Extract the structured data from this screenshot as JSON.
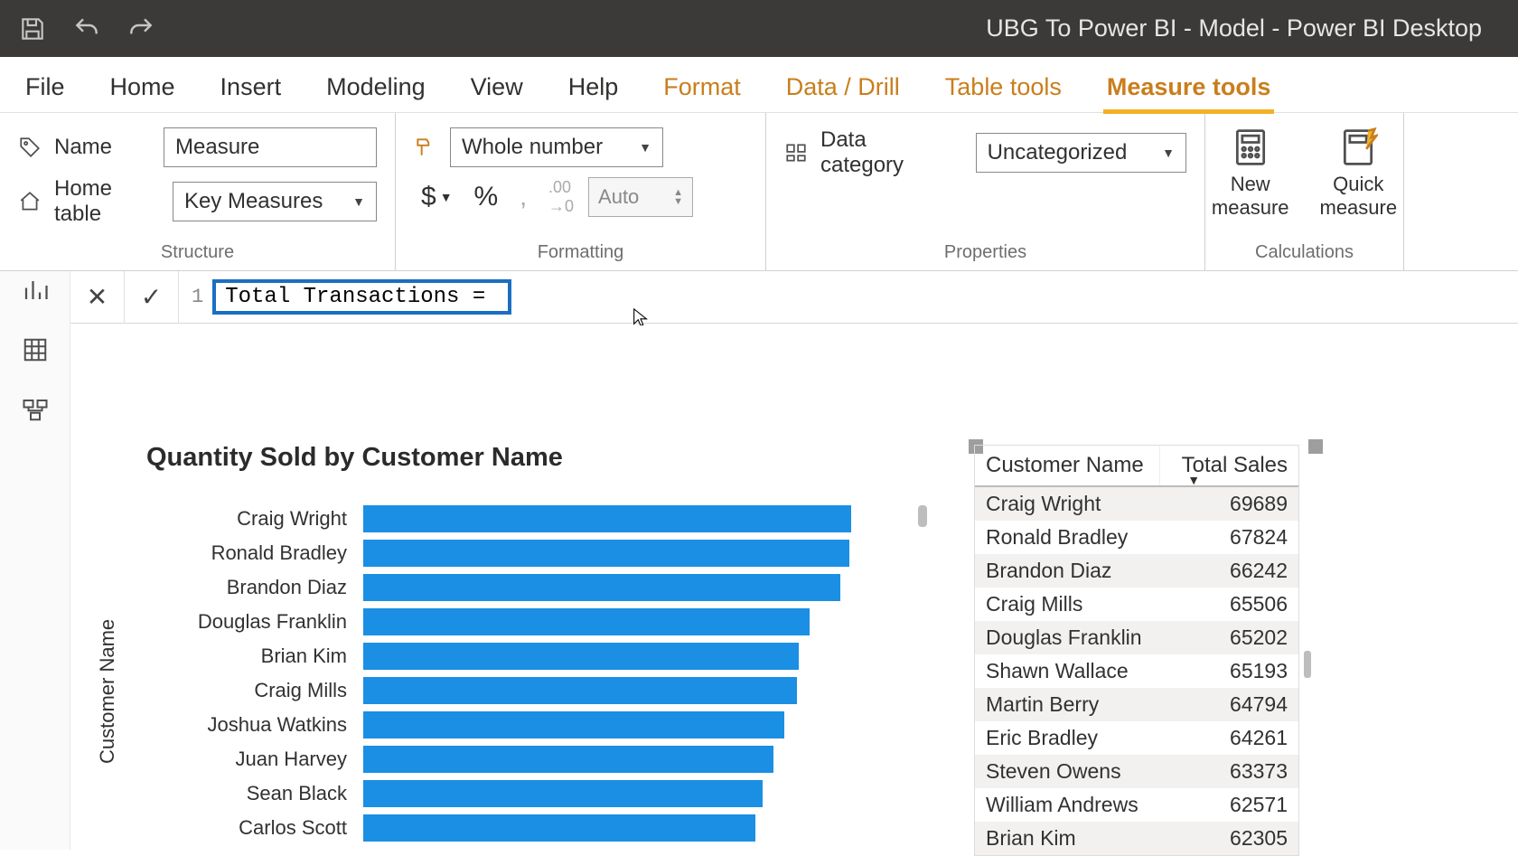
{
  "window_title": "UBG To Power BI - Model - Power BI Desktop",
  "tabs": {
    "file": "File",
    "home": "Home",
    "insert": "Insert",
    "modeling": "Modeling",
    "view": "View",
    "help": "Help",
    "format": "Format",
    "data_drill": "Data / Drill",
    "table_tools": "Table tools",
    "measure_tools": "Measure tools"
  },
  "structure": {
    "name_label": "Name",
    "name_value": "Measure",
    "home_table_label": "Home table",
    "home_table_value": "Key Measures",
    "group_label": "Structure"
  },
  "formatting": {
    "format_value": "Whole number",
    "decimal_auto": "Auto",
    "group_label": "Formatting"
  },
  "properties": {
    "data_category_label": "Data category",
    "data_category_value": "Uncategorized",
    "group_label": "Properties"
  },
  "calculations": {
    "new_measure": "New\nmeasure",
    "quick_measure": "Quick\nmeasure",
    "group_label": "Calculations"
  },
  "formula": {
    "line_no": "1",
    "code": "Total Transactions = "
  },
  "chart_data": {
    "type": "bar",
    "title": "Quantity Sold by Customer Name",
    "ylabel": "Customer Name",
    "categories": [
      "Craig Wright",
      "Ronald Bradley",
      "Brandon Diaz",
      "Douglas Franklin",
      "Brian Kim",
      "Craig Mills",
      "Joshua Watkins",
      "Juan Harvey",
      "Sean Black",
      "Carlos Scott"
    ],
    "values": [
      450,
      448,
      440,
      412,
      402,
      400,
      388,
      378,
      368,
      362
    ],
    "xlim": [
      0,
      500
    ]
  },
  "table": {
    "columns": [
      "Customer Name",
      "Total Sales"
    ],
    "sort_column": "Total Sales",
    "rows": [
      {
        "name": "Craig Wright",
        "sales": "69689"
      },
      {
        "name": "Ronald Bradley",
        "sales": "67824"
      },
      {
        "name": "Brandon Diaz",
        "sales": "66242"
      },
      {
        "name": "Craig Mills",
        "sales": "65506"
      },
      {
        "name": "Douglas Franklin",
        "sales": "65202"
      },
      {
        "name": "Shawn Wallace",
        "sales": "65193"
      },
      {
        "name": "Martin Berry",
        "sales": "64794"
      },
      {
        "name": "Eric Bradley",
        "sales": "64261"
      },
      {
        "name": "Steven Owens",
        "sales": "63373"
      },
      {
        "name": "William Andrews",
        "sales": "62571"
      },
      {
        "name": "Brian Kim",
        "sales": "62305"
      }
    ]
  }
}
